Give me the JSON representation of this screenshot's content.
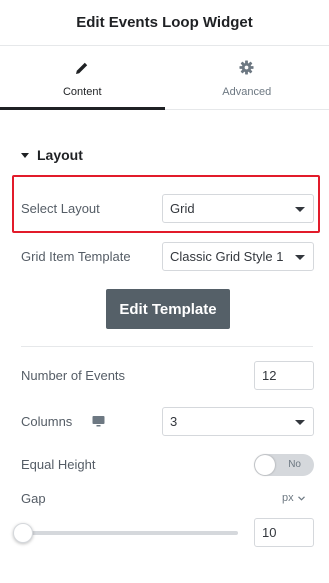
{
  "panel": {
    "title": "Edit Events Loop Widget"
  },
  "tabs": [
    {
      "label": "Content",
      "icon": "pencil-icon",
      "active": true
    },
    {
      "label": "Advanced",
      "icon": "gear-icon",
      "active": false
    }
  ],
  "section": {
    "title": "Layout"
  },
  "controls": {
    "select_layout": {
      "label": "Select Layout",
      "value": "Grid"
    },
    "grid_item_template": {
      "label": "Grid Item Template",
      "value": "Classic Grid Style 1"
    },
    "edit_template_button": "Edit Template",
    "number_of_events": {
      "label": "Number of Events",
      "value": "12"
    },
    "columns": {
      "label": "Columns",
      "device_icon": "desktop-icon",
      "value": "3"
    },
    "equal_height": {
      "label": "Equal Height",
      "state": "No"
    },
    "gap": {
      "label": "Gap",
      "unit": "px",
      "value": "10",
      "slider_fraction": 0.0
    }
  },
  "colors": {
    "highlight": "#e21b2a",
    "button": "#556068",
    "active_tab": "#1f2124"
  }
}
